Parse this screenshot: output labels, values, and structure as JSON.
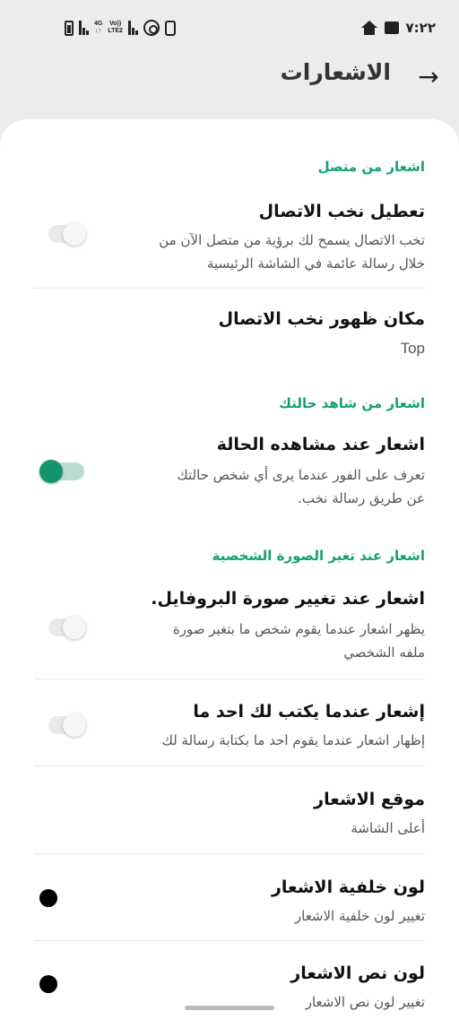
{
  "status_bar": {
    "time": "٧:٢٢",
    "network_top": "4G",
    "network_bottom": "LTE2",
    "volte_top": "Vo))",
    "volte_bottom": "LTE2"
  },
  "header": {
    "title": "الاشعارات",
    "back_icon": "arrow-back-icon"
  },
  "sections": {
    "online": {
      "label": "اشعار من متصل",
      "disable_toast": {
        "title": "تعطيل نخب الاتصال",
        "subtitle": "تخب الاتصال يسمح لك برؤية من متصل الآن من خلال رسالة عائمة في الشاشة الرئيسية",
        "enabled": false
      },
      "toast_position": {
        "title": "مكان ظهور نخب الاتصال",
        "value": "Top"
      }
    },
    "status_viewer": {
      "label": "اشعار من شاهد حالتك",
      "view_notify": {
        "title": "اشعار عند مشاهده الحالة",
        "subtitle": "تعرف على الفور عندما يرى أي شخص حالتك عن طريق رسالة نخب.",
        "enabled": true
      }
    },
    "profile_photo": {
      "label": "اشعار عند تغير الصورة الشخصية",
      "change_notify": {
        "title": "اشعار عند تغيير صورة البروفايل.",
        "subtitle": "يظهر اشعار عندما يقوم شخص ما بتغير صورة ملفه الشخصي",
        "enabled": false
      },
      "typing_notify": {
        "title": "إشعار عندما يكتب لك احد ما",
        "subtitle": "إظهار اشعار عندما يقوم احد ما بكتابة رسالة لك",
        "enabled": false
      },
      "notify_position": {
        "title": "موقع الاشعار",
        "subtitle": "أعلى الشاشة"
      },
      "bg_color": {
        "title": "لون خلفية الاشعار",
        "subtitle": "تغيير لون خلفية الاشعار",
        "color": "#000000"
      },
      "text_color": {
        "title": "لون نص الاشعار",
        "subtitle": "تغيير لون نص الاشعار",
        "color": "#000000"
      }
    }
  },
  "colors": {
    "accent": "#14a076",
    "toggle_on": "#14946c",
    "background": "#ececec",
    "card": "#ffffff"
  }
}
